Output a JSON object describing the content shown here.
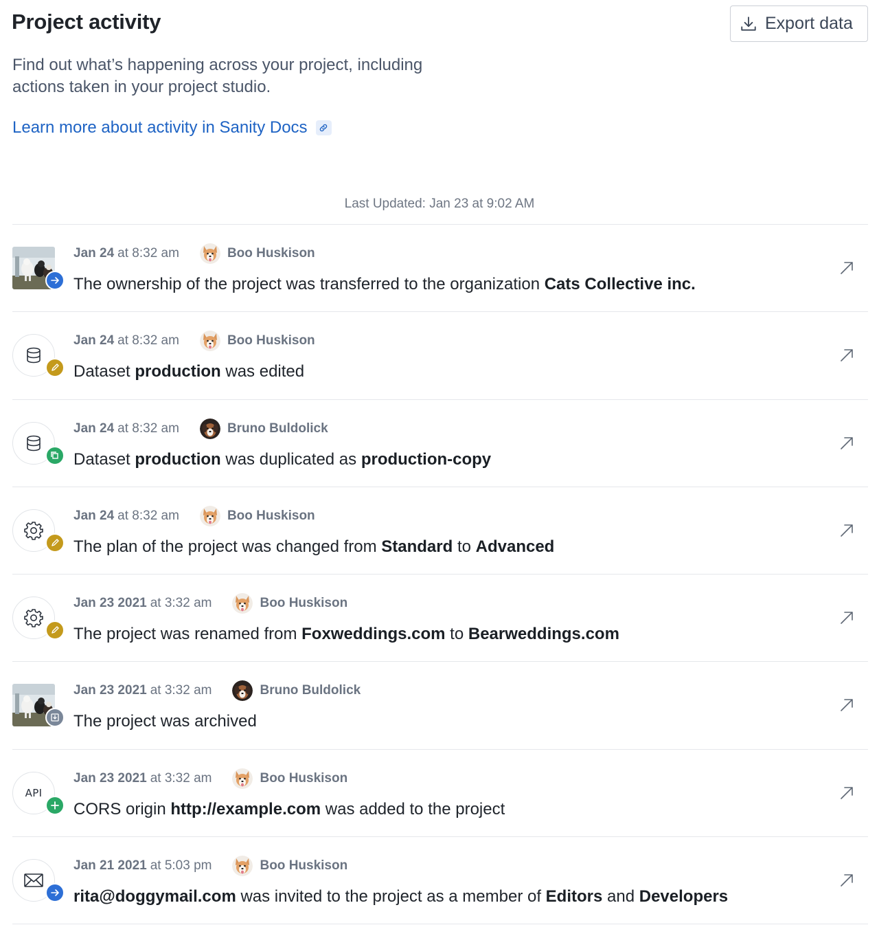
{
  "header": {
    "title": "Project activity",
    "export_label": "Export data",
    "intro_line1": "Find out what’s happening across your project, including",
    "intro_line2": "actions taken in your project studio.",
    "docs_link": "Learn more about activity in Sanity Docs",
    "last_updated": "Last Updated: Jan 23 at 9:02 AM"
  },
  "colors": {
    "accent": "#1e63c4",
    "badge_blue": "#2d6fd6",
    "badge_yellow": "#c49a1c",
    "badge_green": "#2aa866",
    "badge_gray": "#7a8799"
  },
  "activity": [
    {
      "icon": "project-thumbnail",
      "badge": "arrow-right-icon",
      "date": "Jan 24",
      "time": "at 8:32 am",
      "user": "Boo Huskison",
      "avatar": "corgi",
      "desc": [
        {
          "t": "The ownership of the project was transferred to the organization "
        },
        {
          "t": "Cats Collective inc.",
          "b": true
        }
      ]
    },
    {
      "icon": "database-icon",
      "badge": "pencil-icon",
      "date": "Jan 24",
      "time": "at 8:32 am",
      "user": "Boo Huskison",
      "avatar": "corgi",
      "desc": [
        {
          "t": "Dataset "
        },
        {
          "t": "production",
          "b": true
        },
        {
          "t": " was edited"
        }
      ]
    },
    {
      "icon": "database-icon",
      "badge": "duplicate-icon",
      "date": "Jan 24",
      "time": "at 8:32 am",
      "user": "Bruno Buldolick",
      "avatar": "dog-dark",
      "desc": [
        {
          "t": "Dataset "
        },
        {
          "t": "production",
          "b": true
        },
        {
          "t": " was duplicated as "
        },
        {
          "t": "production-copy",
          "b": true
        }
      ]
    },
    {
      "icon": "gear-icon",
      "badge": "pencil-icon",
      "date": "Jan 24",
      "time": "at 8:32 am",
      "user": "Boo Huskison",
      "avatar": "corgi",
      "desc": [
        {
          "t": "The plan of the project was changed from "
        },
        {
          "t": "Standard",
          "b": true
        },
        {
          "t": " to "
        },
        {
          "t": "Advanced",
          "b": true
        }
      ]
    },
    {
      "icon": "gear-icon",
      "badge": "pencil-icon",
      "date": "Jan 23 2021",
      "time": "at 3:32 am",
      "user": "Boo Huskison",
      "avatar": "corgi",
      "desc": [
        {
          "t": "The project was renamed from "
        },
        {
          "t": "Foxweddings.com",
          "b": true
        },
        {
          "t": " to "
        },
        {
          "t": "Bearweddings.com",
          "b": true
        }
      ]
    },
    {
      "icon": "project-thumbnail",
      "badge": "archive-icon",
      "date": "Jan 23 2021",
      "time": "at 3:32 am",
      "user": "Bruno Buldolick",
      "avatar": "dog-dark",
      "desc": [
        {
          "t": "The project was archived"
        }
      ]
    },
    {
      "icon": "api-icon",
      "icon_text": "API",
      "badge": "plus-icon",
      "date": "Jan 23 2021",
      "time": "at 3:32 am",
      "user": "Boo Huskison",
      "avatar": "corgi",
      "desc": [
        {
          "t": "CORS origin "
        },
        {
          "t": "http://example.com",
          "b": true
        },
        {
          "t": " was added to the project"
        }
      ]
    },
    {
      "icon": "envelope-icon",
      "badge": "arrow-right-icon",
      "date": "Jan 21 2021",
      "time": "at 5:03 pm",
      "user": "Boo Huskison",
      "avatar": "corgi",
      "desc": [
        {
          "t": "rita@doggymail.com",
          "b": true
        },
        {
          "t": " was invited to the project as a member of "
        },
        {
          "t": "Editors",
          "b": true
        },
        {
          "t": " and "
        },
        {
          "t": "Developers",
          "b": true
        }
      ]
    }
  ]
}
